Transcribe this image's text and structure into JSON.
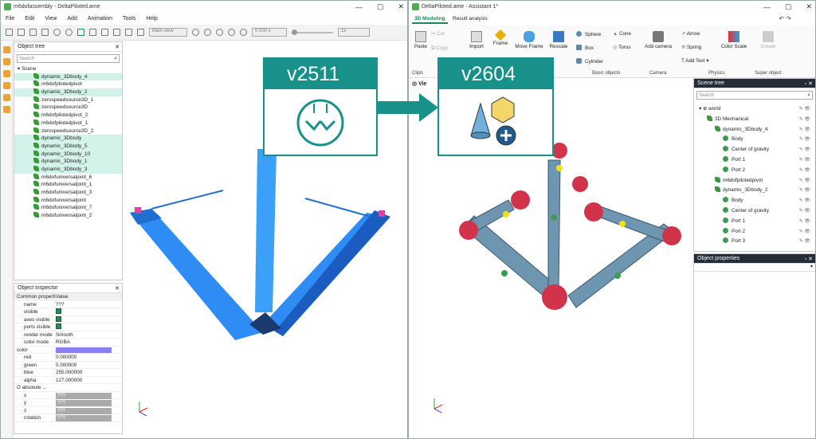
{
  "left_window": {
    "title": "m6dofassembly - DeltaPiloted.ame",
    "menu": [
      "File",
      "Edit",
      "View",
      "Add",
      "Animation",
      "Tools",
      "Help"
    ],
    "toolbar": {
      "view_select": "Main view",
      "time_value": "0.000 s",
      "speed": "1x"
    },
    "object_tree": {
      "title": "Object tree",
      "search_placeholder": "Search",
      "root": "Scene",
      "items": [
        {
          "label": "dynamic_3Dbody_4",
          "highlighted": true
        },
        {
          "label": "m6dofpilotedpivot",
          "highlighted": false
        },
        {
          "label": "dynamic_3Dbody_2",
          "highlighted": true
        },
        {
          "label": "zerospeedsource3D_1",
          "highlighted": false
        },
        {
          "label": "zerospeedsource3D",
          "highlighted": false
        },
        {
          "label": "m6dofpilotedpivot_2",
          "highlighted": false
        },
        {
          "label": "m6dofpilotedpivot_1",
          "highlighted": false
        },
        {
          "label": "zerospeedsource3D_2",
          "highlighted": false
        },
        {
          "label": "dynamic_3Dbody",
          "highlighted": true
        },
        {
          "label": "dynamic_3Dbody_5",
          "highlighted": true
        },
        {
          "label": "dynamic_3Dbody_10",
          "highlighted": true
        },
        {
          "label": "dynamic_3Dbody_1",
          "highlighted": true
        },
        {
          "label": "dynamic_3Dbody_3",
          "highlighted": true
        },
        {
          "label": "m6dofuniversaljoint_6",
          "highlighted": false
        },
        {
          "label": "m6dofuniversaljoint_1",
          "highlighted": false
        },
        {
          "label": "m6dofuniversaljoint_3",
          "highlighted": false
        },
        {
          "label": "m6dofuniversaljoint",
          "highlighted": false
        },
        {
          "label": "m6dofuniversaljoint_7",
          "highlighted": false
        },
        {
          "label": "m6dofuniversaljoint_2",
          "highlighted": false
        }
      ]
    },
    "object_inspector": {
      "title": "Object inspector",
      "col_property": "Common properti",
      "col_value": "Value",
      "rows": [
        {
          "k": "name",
          "v": "???"
        },
        {
          "k": "visible",
          "v": "checked"
        },
        {
          "k": "axes visible",
          "v": "checked"
        },
        {
          "k": "ports visible",
          "v": "checked"
        },
        {
          "k": "render mode",
          "v": "Smooth"
        },
        {
          "k": "color mode",
          "v": "RGBA"
        },
        {
          "k": "color",
          "v": "swatch"
        },
        {
          "k": "red",
          "v": "0.000000"
        },
        {
          "k": "green",
          "v": "0.000000"
        },
        {
          "k": "blue",
          "v": "255.000000"
        },
        {
          "k": "alpha",
          "v": "127.000000"
        },
        {
          "k": "O absolute ...",
          "v": ""
        },
        {
          "k": "x",
          "v": "???"
        },
        {
          "k": "y",
          "v": "???"
        },
        {
          "k": "z",
          "v": "???"
        },
        {
          "k": "rotation",
          "v": "???"
        }
      ],
      "color_swatch": "#8a80f0"
    }
  },
  "right_window": {
    "title": "DeltaPiloted.ame - Assistant 1*",
    "tabs": [
      "3D Modeling",
      "Result analysis"
    ],
    "ribbon": {
      "clipboard": {
        "paste": "Paste",
        "cut": "Cut",
        "copy": "Copy",
        "group": "Clipb"
      },
      "import": "Import",
      "frame": "Frame",
      "move_frame": "Move Frame",
      "rescale": "Rescale",
      "basic_objects": {
        "sphere": "Sphere",
        "cone": "Cone",
        "box": "Box",
        "torus": "Torus",
        "cylinder": "Cylinder",
        "group": "Basic objects"
      },
      "camera": {
        "add_camera": "Add camera",
        "group": "Camera"
      },
      "physics": {
        "arrow": "Arrow",
        "spring": "Spring",
        "add_text": "Add Text",
        "color_scale": "Color Scale",
        "group": "Physics"
      },
      "super_object": {
        "create": "Create",
        "group": "Super object"
      }
    },
    "view_tab": "Vie",
    "scene_tree": {
      "title": "Scene tree",
      "search_placeholder": "Search",
      "items": [
        {
          "label": "world",
          "level": 0
        },
        {
          "label": "3D Mechanical",
          "level": 1
        },
        {
          "label": "dynamic_3Dbody_4",
          "level": 2
        },
        {
          "label": "Body",
          "level": 3
        },
        {
          "label": "Center of gravity",
          "level": 3
        },
        {
          "label": "Port 1",
          "level": 3
        },
        {
          "label": "Port 2",
          "level": 3
        },
        {
          "label": "m6dofpilotedpivot",
          "level": 2
        },
        {
          "label": "dynamic_3Dbody_2",
          "level": 2
        },
        {
          "label": "Body",
          "level": 3
        },
        {
          "label": "Center of gravity",
          "level": 3
        },
        {
          "label": "Port 1",
          "level": 3
        },
        {
          "label": "Port 2",
          "level": 3
        },
        {
          "label": "Port 3",
          "level": 3
        }
      ]
    },
    "object_properties": {
      "title": "Object properties"
    }
  },
  "callouts": {
    "old": "v2511",
    "new": "v2604"
  },
  "colors": {
    "teal": "#17918a",
    "accent_green": "#1a8a5a",
    "highlight": "#d3f3ea"
  }
}
